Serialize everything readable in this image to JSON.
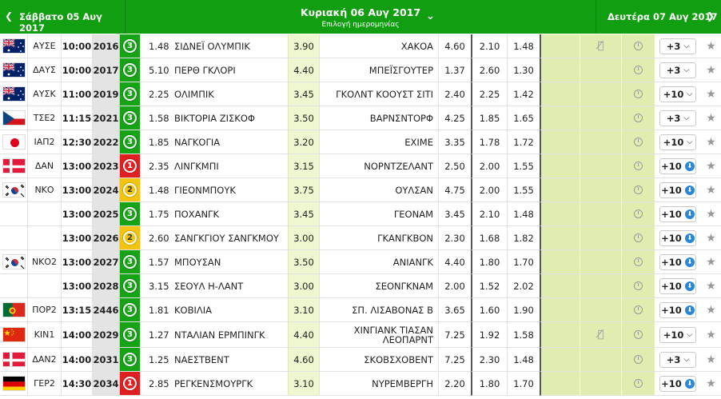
{
  "header": {
    "prev_arrow": "❮",
    "prev_date": "Σάββατο 05 Αυγ 2017",
    "current_date": "Κυριακή 06 Αυγ 2017",
    "current_sub": "Επιλογή ημερομηνίας",
    "chevron": "⌄",
    "next_date": "Δευτέρα 07 Αυγ 2017",
    "next_arrow": "❯"
  },
  "colors": {
    "brand_green": "#119f11",
    "badge_green": "#16a316",
    "badge_red": "#e02020",
    "badge_yellow": "#f2c410",
    "highlight": "#dfeeb0",
    "download_blue": "#2a87d8"
  },
  "rows": [
    {
      "flag": "australia",
      "league": "ΑΥΣΕ",
      "time": "10:00",
      "code": "2016",
      "badge": "3",
      "badge_color": "green",
      "odd1": "1.48",
      "home": "ΣΙΔΝΕΪ ΟΛΥΜΠΙΚ",
      "oddx": "3.90",
      "away": "ΧΑΚΟΑ",
      "odd2": "4.60",
      "under": "2.10",
      "over": "1.48",
      "nomic": true,
      "more": "+3",
      "more_icon": "dropdown"
    },
    {
      "flag": "australia",
      "league": "ΔΑΥΣ",
      "time": "10:00",
      "code": "2017",
      "badge": "3",
      "badge_color": "green",
      "odd1": "5.10",
      "home": "ΠΕΡΘ ΓΚΛΟΡΙ",
      "oddx": "4.40",
      "away": "ΜΠΕΪΣΓΟΥΤΕΡ",
      "odd2": "1.37",
      "under": "2.60",
      "over": "1.30",
      "nomic": false,
      "more": "+3",
      "more_icon": "dropdown"
    },
    {
      "flag": "australia",
      "league": "ΑΥΣΚ",
      "time": "11:00",
      "code": "2019",
      "badge": "3",
      "badge_color": "green",
      "odd1": "2.25",
      "home": "ΟΛΙΜΠΙΚ",
      "oddx": "3.45",
      "away": "ΓΚΟΛΝΤ ΚΟΟΥΣΤ ΣΙΤΙ",
      "odd2": "2.40",
      "under": "2.25",
      "over": "1.42",
      "nomic": false,
      "more": "+10",
      "more_icon": "dropdown"
    },
    {
      "flag": "czech",
      "league": "ΤΣΕ2",
      "time": "11:15",
      "code": "2021",
      "badge": "3",
      "badge_color": "green",
      "odd1": "1.58",
      "home": "ΒΙΚΤΟΡΙΑ ΖΙΣΚΟΦ",
      "oddx": "3.50",
      "away": "ΒΑΡΝΣΝΤΟΡΦ",
      "odd2": "4.25",
      "under": "1.85",
      "over": "1.65",
      "nomic": false,
      "more": "+3",
      "more_icon": "dropdown"
    },
    {
      "flag": "japan",
      "league": "ΙΑΠ2",
      "time": "12:30",
      "code": "2022",
      "badge": "3",
      "badge_color": "green",
      "odd1": "1.85",
      "home": "ΝΑΓΚΟΓΙΑ",
      "oddx": "3.20",
      "away": "ΕΧΙΜΕ",
      "odd2": "3.35",
      "under": "1.78",
      "over": "1.72",
      "nomic": false,
      "more": "+10",
      "more_icon": "dropdown"
    },
    {
      "flag": "denmark",
      "league": "ΔΑΝ",
      "time": "13:00",
      "code": "2023",
      "badge": "1",
      "badge_color": "red",
      "odd1": "2.35",
      "home": "ΛΙΝΓΚΜΠΙ",
      "oddx": "3.15",
      "away": "ΝΟΡΝΤΖΕΛΑΝΤ",
      "odd2": "2.50",
      "under": "2.00",
      "over": "1.55",
      "nomic": false,
      "more": "+10",
      "more_icon": "download"
    },
    {
      "flag": "korea",
      "league": "ΝΚΟ",
      "time": "13:00",
      "code": "2024",
      "badge": "2",
      "badge_color": "yellow",
      "odd1": "1.48",
      "home": "ΓΙΕΟΝΜΠΟΥΚ",
      "oddx": "3.75",
      "away": "ΟΥΛΣΑΝ",
      "odd2": "4.75",
      "under": "2.00",
      "over": "1.55",
      "nomic": false,
      "more": "+10",
      "more_icon": "download"
    },
    {
      "flag": "",
      "league": "",
      "time": "13:00",
      "code": "2025",
      "badge": "3",
      "badge_color": "green",
      "odd1": "1.75",
      "home": "ΠΟΧΑΝΓΚ",
      "oddx": "3.45",
      "away": "ΓΕΟΝΑΜ",
      "odd2": "3.45",
      "under": "2.10",
      "over": "1.48",
      "nomic": false,
      "more": "+10",
      "more_icon": "download"
    },
    {
      "flag": "",
      "league": "",
      "time": "13:00",
      "code": "2026",
      "badge": "2",
      "badge_color": "yellow",
      "odd1": "2.60",
      "home": "ΣΑΝΓΚΓΙΟΥ ΣΑΝΓΚΜΟΥ",
      "oddx": "3.00",
      "away": "ΓΚΑΝΓΚΒΟΝ",
      "odd2": "2.30",
      "under": "1.68",
      "over": "1.82",
      "nomic": false,
      "more": "+10",
      "more_icon": "download"
    },
    {
      "flag": "korea",
      "league": "ΝΚΟ2",
      "time": "13:00",
      "code": "2027",
      "badge": "3",
      "badge_color": "green",
      "odd1": "1.57",
      "home": "ΜΠΟΥΣΑΝ",
      "oddx": "3.50",
      "away": "ΑΝΙΑΝΓΚ",
      "odd2": "4.40",
      "under": "1.80",
      "over": "1.70",
      "nomic": false,
      "more": "+10",
      "more_icon": "download"
    },
    {
      "flag": "",
      "league": "",
      "time": "13:00",
      "code": "2028",
      "badge": "3",
      "badge_color": "green",
      "odd1": "3.15",
      "home": "ΣΕΟΥΛ Η-ΛΑΝΤ",
      "oddx": "3.00",
      "away": "ΣΕΟΝΓΚΝΑΜ",
      "odd2": "2.00",
      "under": "1.52",
      "over": "2.02",
      "nomic": false,
      "more": "+10",
      "more_icon": "download"
    },
    {
      "flag": "portugal",
      "league": "ΠΟΡ2",
      "time": "13:15",
      "code": "2446",
      "badge": "3",
      "badge_color": "green",
      "odd1": "1.81",
      "home": "ΚΟΒΙΛΙΑ",
      "oddx": "3.10",
      "away": "ΣΠ. ΛΙΣΑΒΟΝΑΣ Β",
      "odd2": "3.65",
      "under": "1.60",
      "over": "1.90",
      "nomic": false,
      "more": "+10",
      "more_icon": "download"
    },
    {
      "flag": "china",
      "league": "ΚΙΝ1",
      "time": "14:00",
      "code": "2029",
      "badge": "3",
      "badge_color": "green",
      "odd1": "1.27",
      "home": "ΝΤΑΛΙΑΝ ΕΡΜΠΙΝΓΚ",
      "oddx": "4.40",
      "away": "ΧΙΝΓΙΑΝΚ ΤΙΑΣΑΝ ΛΕΟΠΑΡΝΤ",
      "odd2": "7.25",
      "under": "1.92",
      "over": "1.58",
      "nomic": true,
      "more": "+10",
      "more_icon": "dropdown"
    },
    {
      "flag": "denmark",
      "league": "ΔΑΝ2",
      "time": "14:00",
      "code": "2031",
      "badge": "3",
      "badge_color": "green",
      "odd1": "1.25",
      "home": "ΝΑΕΣΤΒΕΝΤ",
      "oddx": "4.60",
      "away": "ΣΚΟΒΣΧΟΒΕΝΤ",
      "odd2": "7.25",
      "under": "2.30",
      "over": "1.48",
      "nomic": false,
      "more": "+3",
      "more_icon": "dropdown"
    },
    {
      "flag": "germany",
      "league": "ΓΕΡ2",
      "time": "14:30",
      "code": "2034",
      "badge": "1",
      "badge_color": "red",
      "odd1": "2.85",
      "home": "ΡΕΓΚΕΝΣΜΟΥΡΓΚ",
      "oddx": "3.10",
      "away": "ΝΥΡΕΜΒΕΡΓΗ",
      "odd2": "2.20",
      "under": "1.80",
      "over": "1.70",
      "nomic": false,
      "more": "+10",
      "more_icon": "download"
    }
  ]
}
